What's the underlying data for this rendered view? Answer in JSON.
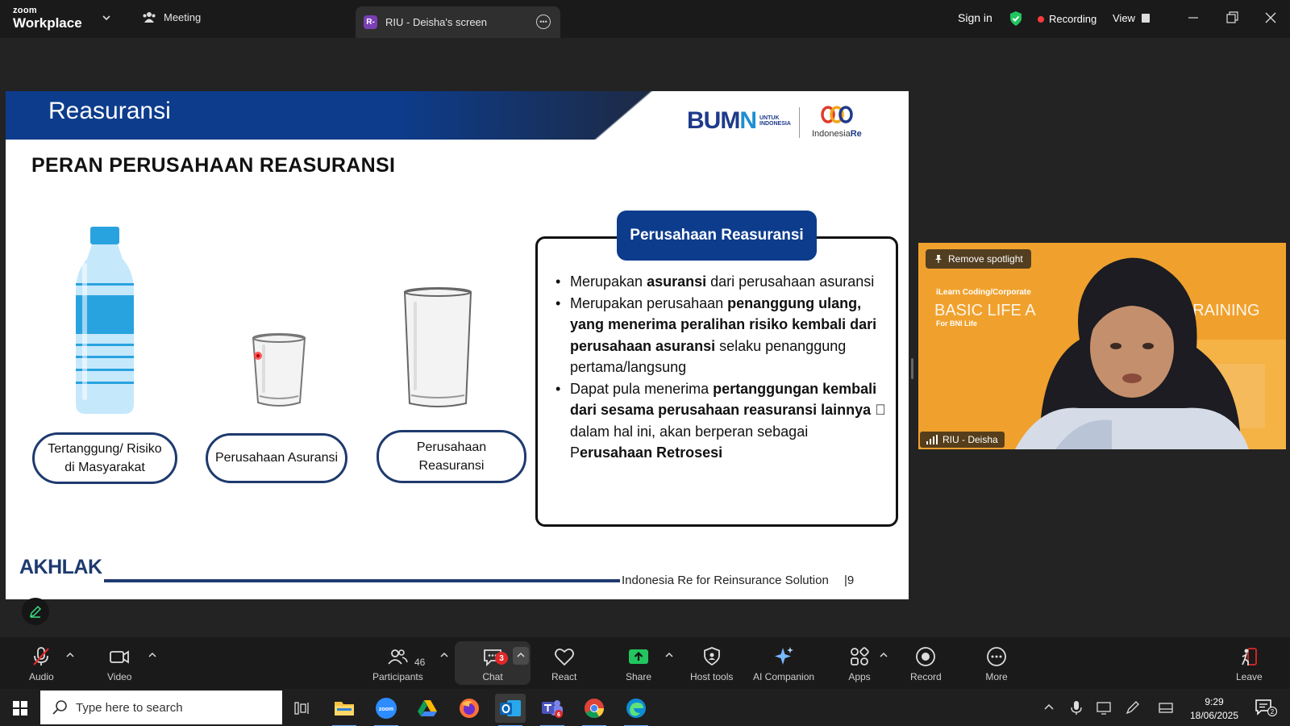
{
  "app": {
    "brand_small": "zoom",
    "brand_large": "Workplace",
    "meeting_tab": "Meeting",
    "screen_tab_badge": "R-",
    "screen_tab": "RIU - Deisha's screen",
    "sign_in": "Sign in",
    "recording": "Recording",
    "view": "View"
  },
  "slide": {
    "title": "Reasuransi",
    "logo_bumn_a": "BUM",
    "logo_bumn_b": "N",
    "logo_bumn_sub1": "UNTUK",
    "logo_bumn_sub2": "INDONESIA",
    "logo_ire_a": "Indonesia",
    "logo_ire_b": "Re",
    "heading": "PERAN PERUSAHAAN REASURANSI",
    "ovals": {
      "tertanggung_line1": "Tertanggung/ Risiko",
      "tertanggung_line2": "di Masyarakat",
      "asuransi": "Perusahaan Asuransi",
      "reasuransi_line1": "Perusahaan",
      "reasuransi_line2": "Reasuransi"
    },
    "box_title": "Perusahaan Reasuransi",
    "bullet1_a": "Merupakan ",
    "bullet1_b": "asuransi",
    "bullet1_c": " dari perusahaan asuransi",
    "bullet2_a": "Merupakan perusahaan ",
    "bullet2_b": "penanggung ulang, yang menerima peralihan risiko kembali dari perusahaan asuransi",
    "bullet2_c": " selaku penanggung pertama/langsung",
    "bullet3_a": "Dapat pula menerima ",
    "bullet3_b": "pertanggungan kembali dari sesama perusahaan reasuransi lainnya",
    "bullet3_c": " \u0000 dalam hal ini, akan berperan sebagai P",
    "bullet3_d": "erusahaan Retrosesi",
    "footer_logo": "AKHLAK",
    "footer_text": "Indonesia Re for Reinsurance Solution",
    "page_number": "|9"
  },
  "video": {
    "remove_spotlight": "Remove spotlight",
    "participant_name": "RIU - Deisha"
  },
  "toolbar": {
    "audio": "Audio",
    "video": "Video",
    "participants": "Participants",
    "participants_count": "46",
    "chat": "Chat",
    "chat_badge": "3",
    "react": "React",
    "share": "Share",
    "host_tools": "Host tools",
    "ai_companion": "AI Companion",
    "apps": "Apps",
    "record": "Record",
    "more": "More",
    "leave": "Leave"
  },
  "taskbar": {
    "search_placeholder": "Type here to search",
    "time": "9:29",
    "date": "18/06/2025",
    "teams_badge": "6",
    "notif_count": "2"
  },
  "colors": {
    "slide_navy": "#0d3c8c",
    "bottle_blue": "#29a3e0",
    "recording_red": "#ff3b3b",
    "shield_green": "#22c55e",
    "video_orange": "#f0a12d"
  }
}
